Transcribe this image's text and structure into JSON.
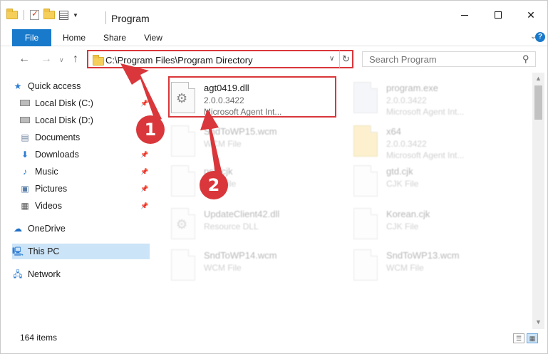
{
  "window": {
    "title": "Program",
    "controls": {
      "minimize": "─",
      "maximize": "☐",
      "close": "✕"
    }
  },
  "ribbon": {
    "tabs": [
      {
        "label": "File"
      },
      {
        "label": "Home"
      },
      {
        "label": "Share"
      },
      {
        "label": "View"
      }
    ],
    "help": "?"
  },
  "address": {
    "path": "C:\\Program Files\\Program Directory",
    "search_placeholder": "Search Program"
  },
  "nav": {
    "items": [
      {
        "label": "Quick access",
        "icon": "star-icon"
      },
      {
        "label": "Local Disk (C:)",
        "icon": "drive-icon"
      },
      {
        "label": "Local Disk (D:)",
        "icon": "drive-icon"
      },
      {
        "label": "Documents",
        "icon": "documents-icon"
      },
      {
        "label": "Downloads",
        "icon": "downloads-icon"
      },
      {
        "label": "Music",
        "icon": "music-icon"
      },
      {
        "label": "Pictures",
        "icon": "pictures-icon"
      },
      {
        "label": "Videos",
        "icon": "videos-icon"
      },
      {
        "label": "OneDrive",
        "icon": "cloud-icon"
      },
      {
        "label": "This PC",
        "icon": "computer-icon"
      },
      {
        "label": "Network",
        "icon": "network-icon"
      }
    ]
  },
  "files": [
    {
      "name": "agt0419.dll",
      "line2": "2.0.0.3422",
      "line3": "Microsoft Agent Int..."
    },
    {
      "name": "program.exe",
      "line2": "2.0.0.3422",
      "line3": "Microsoft Agent Int..."
    },
    {
      "name": "SndToWP15.wcm",
      "line2": "WCM File",
      "line3": ""
    },
    {
      "name": "x64",
      "line2": "2.0.0.3422",
      "line3": "Microsoft Agent Int..."
    },
    {
      "name": "psh.cjk",
      "line2": "CJK File",
      "line3": ""
    },
    {
      "name": "gtd.cjk",
      "line2": "CJK File",
      "line3": ""
    },
    {
      "name": "UpdateClient42.dll",
      "line2": "Resource DLL",
      "line3": ""
    },
    {
      "name": "Korean.cjk",
      "line2": "CJK File",
      "line3": ""
    },
    {
      "name": "SndToWP14.wcm",
      "line2": "WCM File",
      "line3": ""
    },
    {
      "name": "SndToWP13.wcm",
      "line2": "WCM File",
      "line3": ""
    }
  ],
  "status": {
    "count": "164 items"
  },
  "annotations": {
    "step1": "1",
    "step2": "2"
  },
  "colors": {
    "accent": "#1979ca",
    "highlight": "#d9373b",
    "selection": "#cce4f7"
  }
}
